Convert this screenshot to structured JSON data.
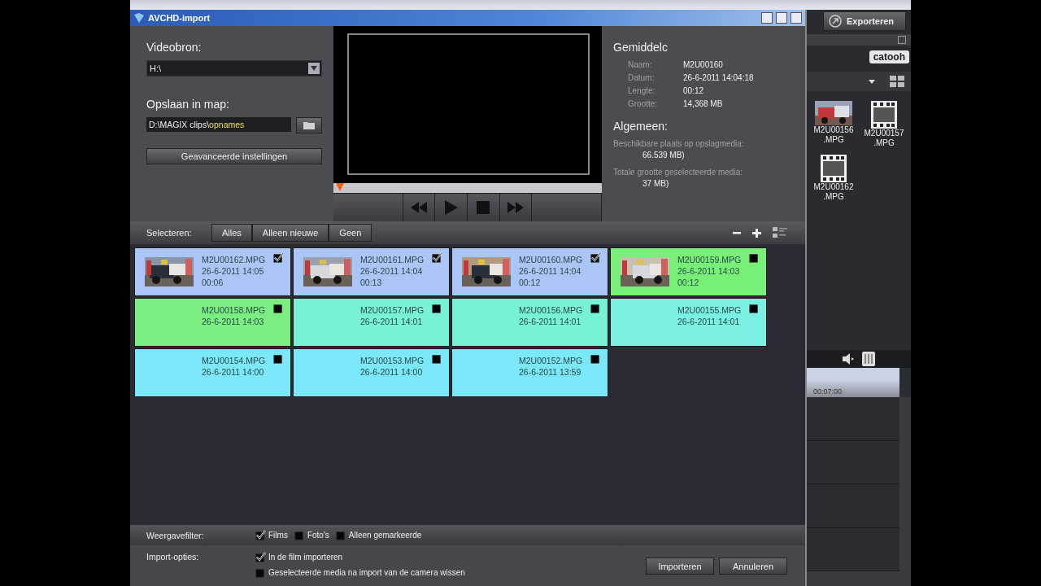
{
  "dialog": {
    "title": "AVCHD-import"
  },
  "source": {
    "label": "Videobron:",
    "value": "H:\\"
  },
  "target": {
    "label": "Opslaan in map:",
    "value": "D:\\MAGIX clips\\",
    "value_highlight": "opnames"
  },
  "advanced_button": "Geavanceerde instellingen",
  "info": {
    "heading": "Gemiddelc",
    "fields": [
      {
        "label": "Naam:",
        "value": "M2U00160"
      },
      {
        "label": "Datum:",
        "value": "26-6-2011 14:04:18"
      },
      {
        "label": "Lengte:",
        "value": "00:12"
      },
      {
        "label": "Grootte:",
        "value": "14,368 MB"
      }
    ],
    "general_heading": "Algemeen:",
    "general": [
      {
        "label": "Beschikbare plaats op opslagmedia:",
        "value": "66.539 MB)"
      },
      {
        "label": "Totale grootte geselecteerde media:",
        "value": "37 MB)"
      }
    ]
  },
  "select_bar": {
    "label": "Selecteren:",
    "buttons": [
      "Alles",
      "Alleen nieuwe",
      "Geen"
    ]
  },
  "clips": [
    {
      "name": "M2U00162.MPG",
      "date": "26-6-2011 14:05",
      "duration": "00:06",
      "checked": true,
      "color": "#aac6f7",
      "kind": "thumbnail"
    },
    {
      "name": "M2U00161.MPG",
      "date": "26-6-2011 14:04",
      "duration": "00:13",
      "checked": true,
      "color": "#aac6f7",
      "kind": "thumbnail"
    },
    {
      "name": "M2U00160.MPG",
      "date": "26-6-2011 14:04",
      "duration": "00:12",
      "checked": true,
      "color": "#aac6f7",
      "kind": "thumbnail"
    },
    {
      "name": "M2U00159.MPG",
      "date": "26-6-2011 14:03",
      "duration": "00:12",
      "checked": false,
      "color": "#78f078",
      "kind": "thumbnail"
    },
    {
      "name": "M2U00158.MPG",
      "date": "26-6-2011 14:03",
      "checked": false,
      "color": "#7aee80",
      "kind": "plain"
    },
    {
      "name": "M2U00157.MPG",
      "date": "26-6-2011 14:01",
      "checked": false,
      "color": "#78f2d4",
      "kind": "plain"
    },
    {
      "name": "M2U00156.MPG",
      "date": "26-6-2011 14:01",
      "checked": false,
      "color": "#78f2d4",
      "kind": "plain"
    },
    {
      "name": "M2U00155.MPG",
      "date": "26-6-2011 14:01",
      "checked": false,
      "color": "#7af0e2",
      "kind": "plain"
    },
    {
      "name": "M2U00154.MPG",
      "date": "26-6-2011 14:00",
      "checked": false,
      "color": "#7ae8f8",
      "kind": "plain"
    },
    {
      "name": "M2U00153.MPG",
      "date": "26-6-2011 14:00",
      "checked": false,
      "color": "#7ae8f8",
      "kind": "plain"
    },
    {
      "name": "M2U00152.MPG",
      "date": "26-6-2011 13:59",
      "checked": false,
      "color": "#7ae8f8",
      "kind": "plain"
    }
  ],
  "filter": {
    "label": "Weergavefilter:",
    "options": [
      {
        "label": "Films",
        "checked": true
      },
      {
        "label": "Foto's",
        "checked": false
      },
      {
        "label": "Alleen gemarkeerde",
        "checked": false
      }
    ]
  },
  "import_options": {
    "label": "Import-opties:",
    "options": [
      {
        "label": "In de film importeren",
        "checked": true
      },
      {
        "label": "Geselecteerde media na import van de camera wissen",
        "checked": false
      }
    ]
  },
  "buttons": [
    "Importeren",
    "Annuleren"
  ],
  "side_panel": {
    "export_button": "Exporteren",
    "logo": "catooh",
    "timeline_time": "00:07:00",
    "media": [
      {
        "name": "M2U00156",
        "ext": ".MPG",
        "kind": "thumbnail"
      },
      {
        "name": "M2U00157",
        "ext": ".MPG",
        "kind": "film"
      },
      {
        "name": "M2U00162",
        "ext": ".MPG",
        "kind": "film"
      }
    ]
  }
}
